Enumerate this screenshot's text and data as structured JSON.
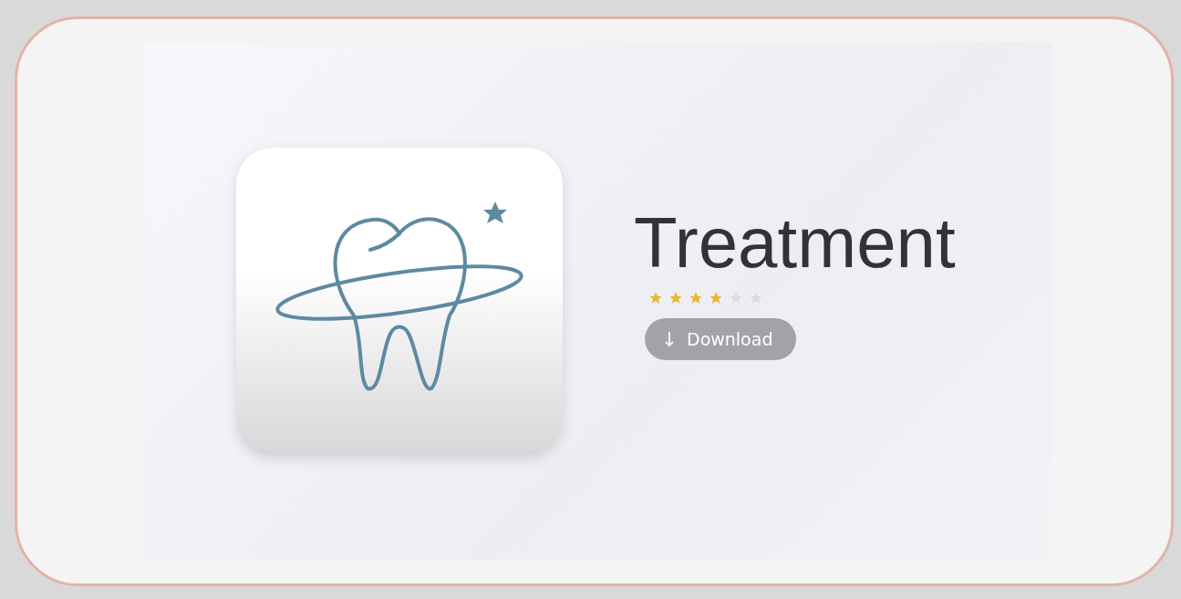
{
  "app": {
    "title": "Treatment",
    "stars": 4,
    "download_button": "Download"
  }
}
